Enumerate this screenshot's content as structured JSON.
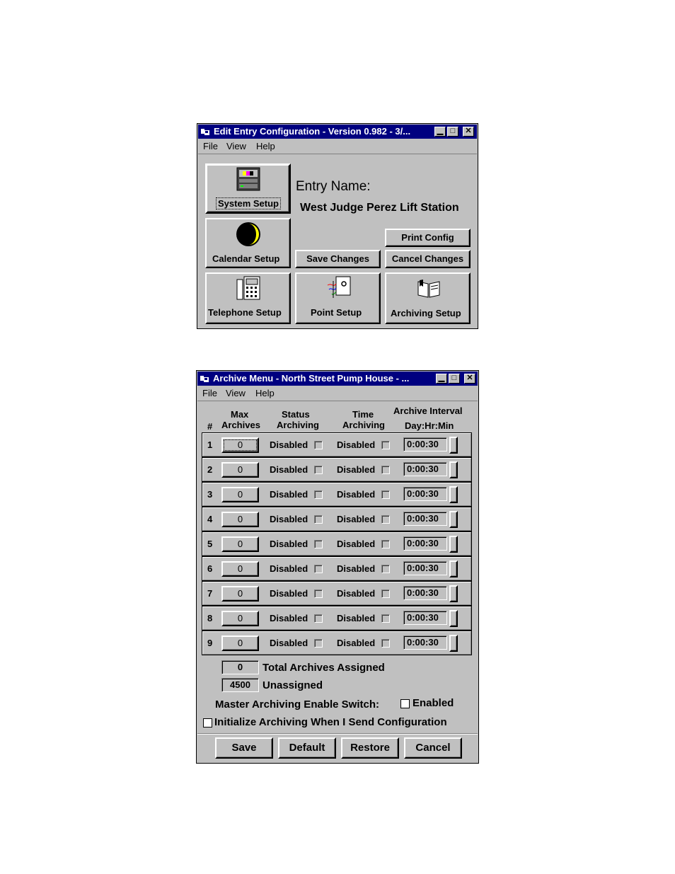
{
  "window1": {
    "title": "Edit Entry Configuration - Version 0.982 - 3/...",
    "menu": [
      "File",
      "View",
      "Help"
    ],
    "entry_name_label": "Entry Name:",
    "entry_name_value": "West Judge Perez Lift Station",
    "buttons": {
      "system_setup": "System Setup",
      "calendar_setup": "Calendar Setup",
      "telephone_setup": "Telephone Setup",
      "point_setup": "Point Setup",
      "archiving_setup": "Archiving Setup",
      "print_config": "Print Config",
      "save_changes": "Save Changes",
      "cancel_changes": "Cancel Changes"
    }
  },
  "window2": {
    "title": "Archive Menu - North Street Pump House - ...",
    "menu": [
      "File",
      "View",
      "Help"
    ],
    "headers": {
      "num": "#",
      "max_1": "Max",
      "max_2": "Archives",
      "status_1": "Status",
      "status_2": "Archiving",
      "time_1": "Time",
      "time_2": "Archiving",
      "interval_1": "Archive Interval",
      "interval_2": "Day:Hr:Min"
    },
    "rows": [
      {
        "num": "1",
        "max": "0",
        "status": "Disabled",
        "time": "Disabled",
        "interval": "0:00:30"
      },
      {
        "num": "2",
        "max": "0",
        "status": "Disabled",
        "time": "Disabled",
        "interval": "0:00:30"
      },
      {
        "num": "3",
        "max": "0",
        "status": "Disabled",
        "time": "Disabled",
        "interval": "0:00:30"
      },
      {
        "num": "4",
        "max": "0",
        "status": "Disabled",
        "time": "Disabled",
        "interval": "0:00:30"
      },
      {
        "num": "5",
        "max": "0",
        "status": "Disabled",
        "time": "Disabled",
        "interval": "0:00:30"
      },
      {
        "num": "6",
        "max": "0",
        "status": "Disabled",
        "time": "Disabled",
        "interval": "0:00:30"
      },
      {
        "num": "7",
        "max": "0",
        "status": "Disabled",
        "time": "Disabled",
        "interval": "0:00:30"
      },
      {
        "num": "8",
        "max": "0",
        "status": "Disabled",
        "time": "Disabled",
        "interval": "0:00:30"
      },
      {
        "num": "9",
        "max": "0",
        "status": "Disabled",
        "time": "Disabled",
        "interval": "0:00:30"
      }
    ],
    "total_value": "0",
    "total_label": "Total Archives Assigned",
    "unassigned_value": "4500",
    "unassigned_label": "Unassigned",
    "master_label": "Master Archiving Enable Switch:",
    "master_checkbox_label": "Enabled",
    "master_checked": false,
    "init_label": "Initialize Archiving When I Send Configuration",
    "init_checked": false,
    "buttons": [
      "Save",
      "Default",
      "Restore",
      "Cancel"
    ]
  }
}
